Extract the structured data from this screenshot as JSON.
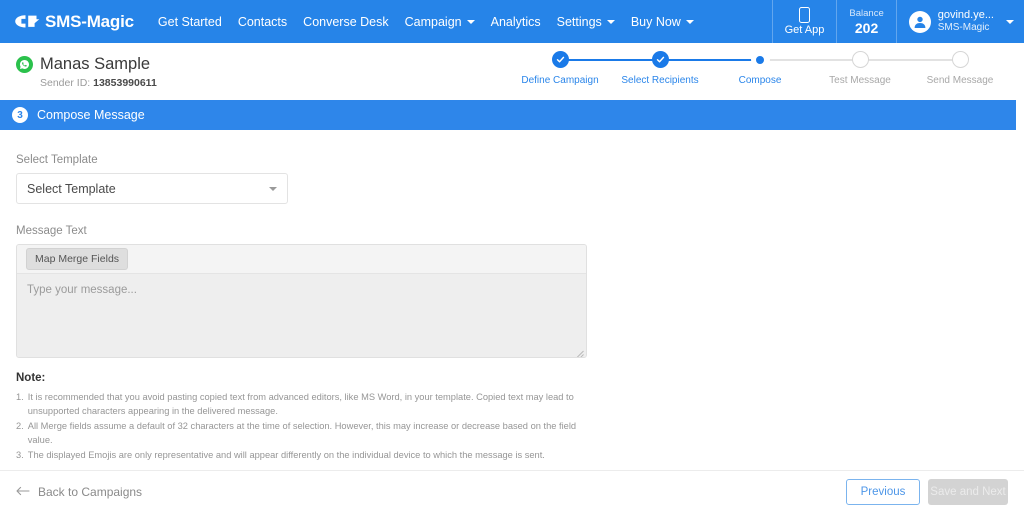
{
  "navbar": {
    "brand": "SMS-Magic",
    "logo_icon": "sms-magic-logo-icon",
    "links": [
      {
        "label": "Get Started",
        "has_caret": false
      },
      {
        "label": "Contacts",
        "has_caret": false
      },
      {
        "label": "Converse Desk",
        "has_caret": false
      },
      {
        "label": "Campaign",
        "has_caret": true
      },
      {
        "label": "Analytics",
        "has_caret": false
      },
      {
        "label": "Settings",
        "has_caret": true
      },
      {
        "label": "Buy Now",
        "has_caret": true
      }
    ],
    "get_app": {
      "label": "Get App",
      "icon": "mobile-phone-icon"
    },
    "balance": {
      "label": "Balance",
      "value": "202"
    },
    "account": {
      "name": "govind.ye...",
      "org": "SMS-Magic",
      "icon": "user-avatar-icon"
    }
  },
  "campaign": {
    "title": "Manas Sample",
    "channel_icon": "whatsapp-icon",
    "sender_label": "Sender ID:",
    "sender_id": "13853990611"
  },
  "stepper": {
    "steps": [
      {
        "label": "Define Campaign",
        "state": "done"
      },
      {
        "label": "Select Recipients",
        "state": "done"
      },
      {
        "label": "Compose",
        "state": "current"
      },
      {
        "label": "Test Message",
        "state": "todo"
      },
      {
        "label": "Send Message",
        "state": "todo"
      }
    ]
  },
  "section": {
    "number": "3",
    "title": "Compose Message"
  },
  "form": {
    "template_label": "Select Template",
    "template_value": "Select Template",
    "message_label": "Message Text",
    "merge_fields_button": "Map Merge Fields",
    "message_placeholder": "Type your message...",
    "message_value": ""
  },
  "note": {
    "title": "Note:",
    "items": [
      {
        "n": "1.",
        "text": "It is recommended that you avoid pasting copied text from advanced editors, like MS Word, in your template. Copied text may lead to unsupported characters appearing in the delivered message."
      },
      {
        "n": "2.",
        "text": "All Merge fields assume a default of 32 characters at the time of selection. However, this may increase or decrease based on the field value."
      },
      {
        "n": "3.",
        "text": "The displayed Emojis are only representative and will appear differently on the individual device to which the message is sent."
      }
    ]
  },
  "footer": {
    "back_label": "Back to Campaigns",
    "back_icon": "arrow-left-icon",
    "previous_label": "Previous",
    "save_next_label": "Save and Next"
  },
  "colors": {
    "brand_blue": "#2684e8",
    "section_blue": "#2e86ea",
    "step_active": "#1a7ae8",
    "whatsapp_green": "#2bc14c",
    "disabled_gray": "#d3d3d3"
  }
}
